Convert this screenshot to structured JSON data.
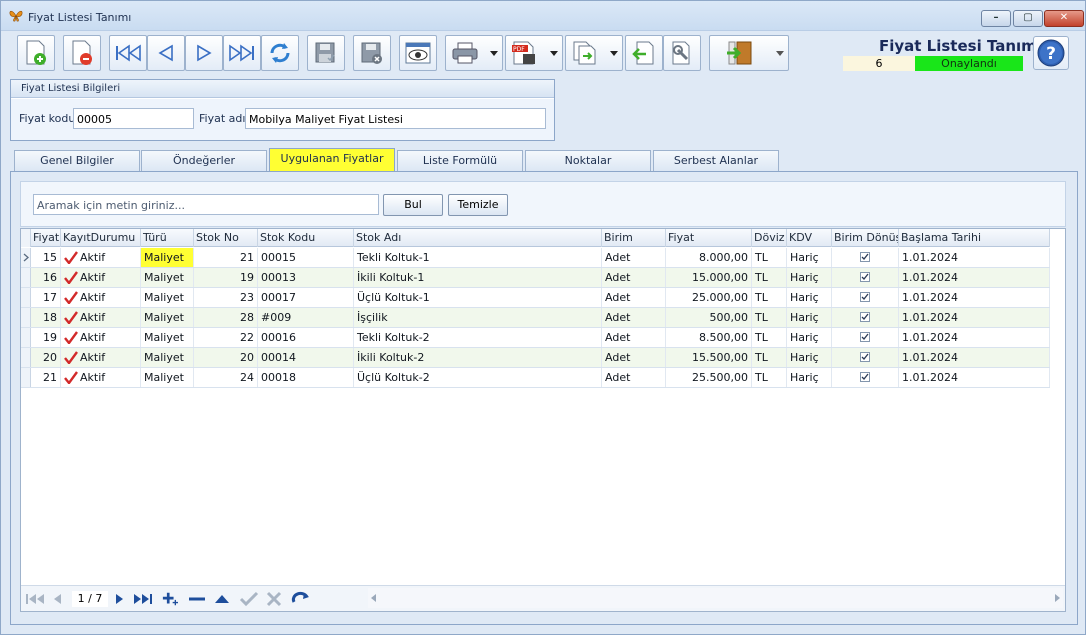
{
  "window": {
    "title": "Fiyat Listesi Tanımı",
    "minimize": "–",
    "maximize": "▢",
    "close": "✕"
  },
  "header": {
    "form_title": "Fiyat Listesi Tanımı",
    "record_number": "6",
    "status": "Onaylandı"
  },
  "group": {
    "title": "Fiyat Listesi Bilgileri",
    "code_label": "Fiyat kodu",
    "code_value": "00005",
    "name_label": "Fiyat adı",
    "name_value": "Mobilya Maliyet Fiyat Listesi"
  },
  "tabs": [
    {
      "label": "Genel Bilgiler"
    },
    {
      "label": "Öndeğerler"
    },
    {
      "label": "Uygulanan Fiyatlar"
    },
    {
      "label": "Liste Formülü"
    },
    {
      "label": "Noktalar"
    },
    {
      "label": "Serbest Alanlar"
    }
  ],
  "search": {
    "placeholder": "Aramak için metin giriniz...",
    "find_label": "Bul",
    "clear_label": "Temizle"
  },
  "grid": {
    "columns": [
      "Fiyat",
      "KayıtDurumu",
      "Türü",
      "Stok No",
      "Stok Kodu",
      "Stok Adı",
      "Birim",
      "Fiyat",
      "Döviz",
      "KDV",
      "Birim Dönüştü",
      "Başlama Tarihi"
    ],
    "rows": [
      {
        "fiyat_no": "15",
        "durum": "Aktif",
        "turu": "Maliyet",
        "stok_no": "21",
        "stok_kodu": "00015",
        "stok_adi": "Tekli Koltuk-1",
        "birim": "Adet",
        "fiyat": "8.000,00",
        "doviz": "TL",
        "kdv": "Hariç",
        "birim_donustur": true,
        "baslama": "1.01.2024"
      },
      {
        "fiyat_no": "16",
        "durum": "Aktif",
        "turu": "Maliyet",
        "stok_no": "19",
        "stok_kodu": "00013",
        "stok_adi": "İkili Koltuk-1",
        "birim": "Adet",
        "fiyat": "15.000,00",
        "doviz": "TL",
        "kdv": "Hariç",
        "birim_donustur": true,
        "baslama": "1.01.2024"
      },
      {
        "fiyat_no": "17",
        "durum": "Aktif",
        "turu": "Maliyet",
        "stok_no": "23",
        "stok_kodu": "00017",
        "stok_adi": "Üçlü Koltuk-1",
        "birim": "Adet",
        "fiyat": "25.000,00",
        "doviz": "TL",
        "kdv": "Hariç",
        "birim_donustur": true,
        "baslama": "1.01.2024"
      },
      {
        "fiyat_no": "18",
        "durum": "Aktif",
        "turu": "Maliyet",
        "stok_no": "28",
        "stok_kodu": "#009",
        "stok_adi": "İşçilik",
        "birim": "Adet",
        "fiyat": "500,00",
        "doviz": "TL",
        "kdv": "Hariç",
        "birim_donustur": true,
        "baslama": "1.01.2024"
      },
      {
        "fiyat_no": "19",
        "durum": "Aktif",
        "turu": "Maliyet",
        "stok_no": "22",
        "stok_kodu": "00016",
        "stok_adi": "Tekli Koltuk-2",
        "birim": "Adet",
        "fiyat": "8.500,00",
        "doviz": "TL",
        "kdv": "Hariç",
        "birim_donustur": true,
        "baslama": "1.01.2024"
      },
      {
        "fiyat_no": "20",
        "durum": "Aktif",
        "turu": "Maliyet",
        "stok_no": "20",
        "stok_kodu": "00014",
        "stok_adi": "İkili Koltuk-2",
        "birim": "Adet",
        "fiyat": "15.500,00",
        "doviz": "TL",
        "kdv": "Hariç",
        "birim_donustur": true,
        "baslama": "1.01.2024"
      },
      {
        "fiyat_no": "21",
        "durum": "Aktif",
        "turu": "Maliyet",
        "stok_no": "24",
        "stok_kodu": "00018",
        "stok_adi": "Üçlü Koltuk-2",
        "birim": "Adet",
        "fiyat": "25.500,00",
        "doviz": "TL",
        "kdv": "Hariç",
        "birim_donustur": true,
        "baslama": "1.01.2024"
      }
    ]
  },
  "navigator": {
    "page_indicator": "1 / 7"
  },
  "colors": {
    "active_tab": "#ffff33",
    "status_ok": "#19e619",
    "check_red": "#d22a2a"
  }
}
